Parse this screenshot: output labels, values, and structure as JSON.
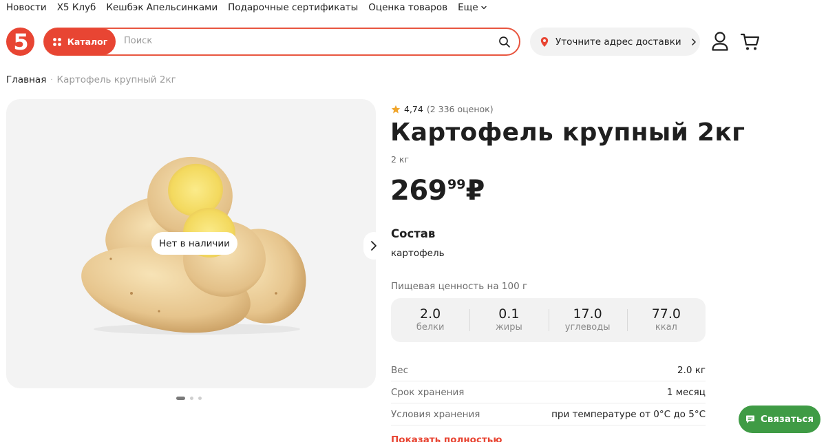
{
  "topnav": {
    "items": [
      "Новости",
      "X5 Клуб",
      "Кешбэк Апельсинками",
      "Подарочные сертификаты",
      "Оценка товаров"
    ],
    "more_label": "Еще"
  },
  "header": {
    "logo_text": "5",
    "catalog_label": "Каталог",
    "search_placeholder": "Поиск",
    "address_label": "Уточните адрес доставки"
  },
  "breadcrumb": {
    "home": "Главная",
    "separator": "·",
    "current": "Картофель крупный 2кг"
  },
  "gallery": {
    "stock_badge": "Нет в наличии",
    "dots_count": 3,
    "active_dot": 0
  },
  "product": {
    "rating": "4,74",
    "rating_count": "(2 336 оценок)",
    "title": "Картофель крупный 2кг",
    "weight": "2 кг",
    "price_rub": "269",
    "price_kop": "99",
    "currency": "₽",
    "composition_heading": "Состав",
    "composition": "картофель",
    "nutrition_caption": "Пищевая ценность на 100 г",
    "nutrition": [
      {
        "value": "2.0",
        "label": "белки"
      },
      {
        "value": "0.1",
        "label": "жиры"
      },
      {
        "value": "17.0",
        "label": "углеводы"
      },
      {
        "value": "77.0",
        "label": "ккал"
      }
    ],
    "properties": [
      {
        "key": "Вес",
        "value": "2.0 кг"
      },
      {
        "key": "Срок хранения",
        "value": "1 месяц"
      },
      {
        "key": "Условия хранения",
        "value": "при температуре от 0°C до 5°C"
      }
    ],
    "show_all": "Показать полностью"
  },
  "chat": {
    "label": "Связаться"
  },
  "colors": {
    "brand_red": "#e84533",
    "chat_green": "#3f9b45",
    "star": "#f0a52b"
  }
}
